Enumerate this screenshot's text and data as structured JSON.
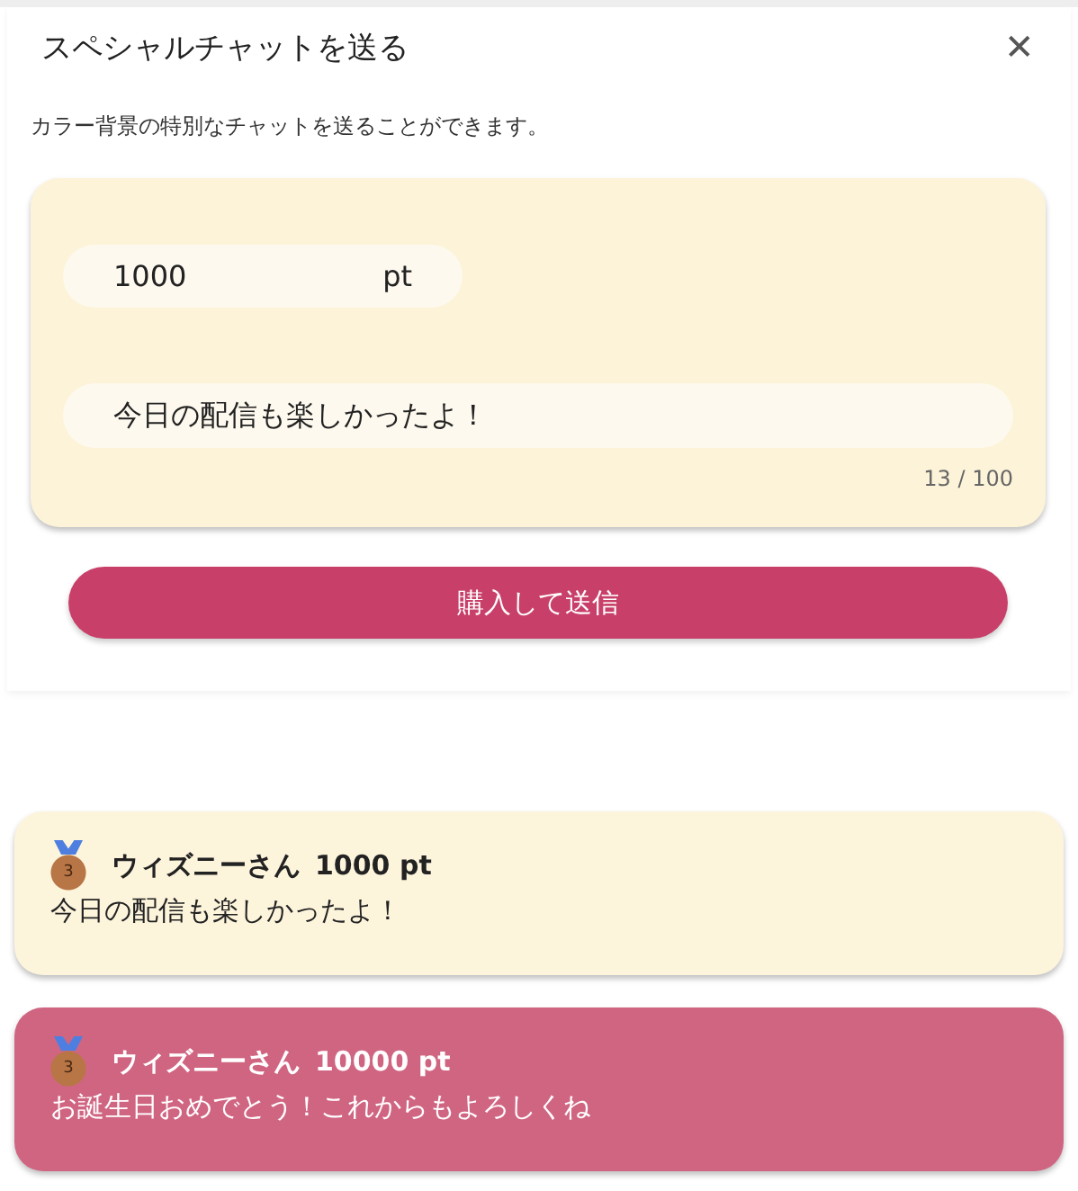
{
  "dialog": {
    "title": "スペシャルチャットを送る",
    "close": "✕",
    "description": "カラー背景の特別なチャットを送ることができます。",
    "amount": {
      "value": "1000",
      "unit": "pt"
    },
    "message": {
      "value": "今日の配信も楽しかったよ！",
      "counter": "13 / 100"
    },
    "submit": "購入して送信"
  },
  "chats": [
    {
      "rank": "3",
      "name": "ウィズニーさん",
      "points": "1000 pt",
      "text": "今日の配信も楽しかったよ！",
      "color": "#fdf4dc"
    },
    {
      "rank": "3",
      "name": "ウィズニーさん",
      "points": "10000 pt",
      "text": "お誕生日おめでとう！これからもよろしくね",
      "color": "#d06582"
    }
  ]
}
